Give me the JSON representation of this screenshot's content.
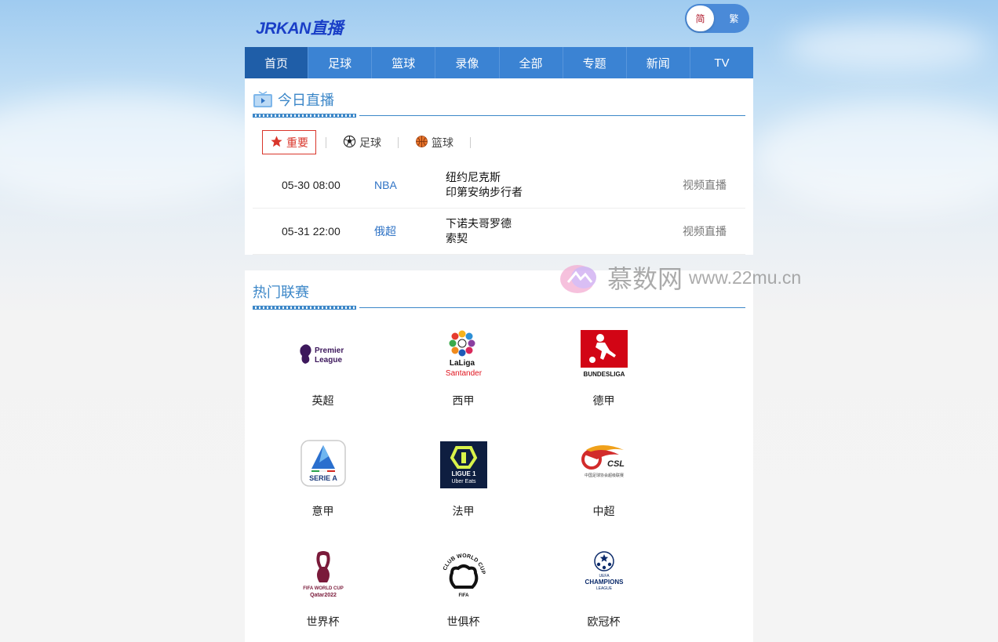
{
  "brand": {
    "logo": "JRKAN直播"
  },
  "lang": {
    "simplified": "简",
    "traditional": "繁"
  },
  "nav": [
    "首页",
    "足球",
    "篮球",
    "录像",
    "全部",
    "专题",
    "新闻",
    "TV"
  ],
  "today": {
    "title": "今日直播",
    "filters": [
      {
        "label": "重要",
        "icon": "star-icon"
      },
      {
        "label": "足球",
        "icon": "soccer-ball-icon"
      },
      {
        "label": "篮球",
        "icon": "basketball-icon"
      }
    ],
    "matches": [
      {
        "time": "05-30 08:00",
        "league": "NBA",
        "home": "纽约尼克斯",
        "away": "印第安纳步行者",
        "link": "视频直播"
      },
      {
        "time": "05-31 22:00",
        "league": "俄超",
        "home": "下诺夫哥罗德",
        "away": "索契",
        "link": "视频直播"
      }
    ]
  },
  "leagues": {
    "title": "热门联赛",
    "items": [
      {
        "name": "英超",
        "logo_text": [
          "Premier",
          "League"
        ]
      },
      {
        "name": "西甲",
        "logo_text": [
          "LaLiga",
          "Santander"
        ]
      },
      {
        "name": "德甲",
        "logo_text": [
          "BUNDESLIGA"
        ]
      },
      {
        "name": "意甲",
        "logo_text": [
          "SERIE A"
        ]
      },
      {
        "name": "法甲",
        "logo_text": [
          "LIGUE 1",
          "Uber Eats"
        ]
      },
      {
        "name": "中超",
        "logo_text": [
          "CSL",
          "中国足球协会超级联赛"
        ]
      },
      {
        "name": "世界杯",
        "logo_text": [
          "FIFA WORLD CUP",
          "Qatar2022"
        ]
      },
      {
        "name": "世俱杯",
        "logo_text": [
          "CLUB WORLD CUP 25",
          "FIFA"
        ]
      },
      {
        "name": "欧冠杯",
        "logo_text": [
          "UEFA",
          "CHAMPIONS",
          "LEAGUE"
        ]
      }
    ]
  },
  "watermark": {
    "name": "慕数网",
    "url": "www.22mu.cn"
  }
}
